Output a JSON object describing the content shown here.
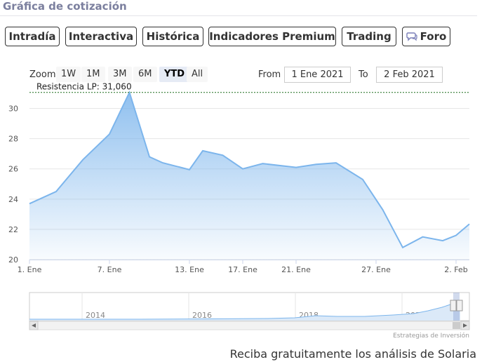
{
  "header": {
    "title": "Gráfica de cotización"
  },
  "tabs": [
    {
      "label": "Intradía",
      "style": "std"
    },
    {
      "label": "Interactiva",
      "style": "std"
    },
    {
      "label": "Histórica",
      "style": "active"
    },
    {
      "label": "Indicadores Premium",
      "style": "premium"
    },
    {
      "label": "Trading",
      "style": "premium"
    },
    {
      "label": "Foro",
      "style": "std",
      "icon": "chat-bubble-icon"
    }
  ],
  "zoom": {
    "label": "Zoom",
    "options": [
      "1W",
      "1M",
      "3M",
      "6M",
      "YTD",
      "All"
    ],
    "selected": "YTD"
  },
  "range": {
    "from_label": "From",
    "from_value": "1 Ene 2021",
    "to_label": "To",
    "to_value": "2 Feb 2021"
  },
  "colors": {
    "line": "#7cb5ec",
    "accent": "#7a7fb8",
    "premium": "#e59a92",
    "resistance": "#1a6b1a"
  },
  "chart_data": {
    "type": "area",
    "x_ticks": [
      {
        "label": "1. Ene",
        "day": 1
      },
      {
        "label": "7. Ene",
        "day": 7
      },
      {
        "label": "13. Ene",
        "day": 13
      },
      {
        "label": "17. Ene",
        "day": 17
      },
      {
        "label": "21. Ene",
        "day": 21
      },
      {
        "label": "27. Ene",
        "day": 27
      },
      {
        "label": "2. Feb",
        "day": 33
      }
    ],
    "y_ticks": [
      20,
      22,
      24,
      26,
      28,
      30
    ],
    "ylim": [
      20,
      31
    ],
    "xlim": [
      1,
      34
    ],
    "series": [
      {
        "points": [
          {
            "day": 1,
            "value": 23.7
          },
          {
            "day": 3,
            "value": 24.5
          },
          {
            "day": 5,
            "value": 26.6
          },
          {
            "day": 7,
            "value": 28.3
          },
          {
            "day": 8.5,
            "value": 31.06
          },
          {
            "day": 10,
            "value": 26.8
          },
          {
            "day": 11,
            "value": 26.4
          },
          {
            "day": 13,
            "value": 25.95
          },
          {
            "day": 14,
            "value": 27.2
          },
          {
            "day": 15.5,
            "value": 26.9
          },
          {
            "day": 17,
            "value": 26.0
          },
          {
            "day": 18.5,
            "value": 26.35
          },
          {
            "day": 21,
            "value": 26.1
          },
          {
            "day": 22.5,
            "value": 26.3
          },
          {
            "day": 24,
            "value": 26.4
          },
          {
            "day": 26,
            "value": 25.3
          },
          {
            "day": 27.5,
            "value": 23.3
          },
          {
            "day": 29,
            "value": 20.8
          },
          {
            "day": 30.5,
            "value": 21.5
          },
          {
            "day": 32,
            "value": 21.25
          },
          {
            "day": 33,
            "value": 21.6
          },
          {
            "day": 34,
            "value": 22.35
          }
        ]
      }
    ],
    "annotations": [
      {
        "label": "Resistencia LP: 31,060",
        "value": 31.06,
        "style": "dashed"
      }
    ],
    "navigator": {
      "year_labels": [
        "2014",
        "2016",
        "2018",
        "2020"
      ]
    },
    "grid": true,
    "legend": "none"
  },
  "credit": "Estrategias de Inversión",
  "footer": {
    "text": "Reciba gratuitamente los análisis de Solaria"
  }
}
